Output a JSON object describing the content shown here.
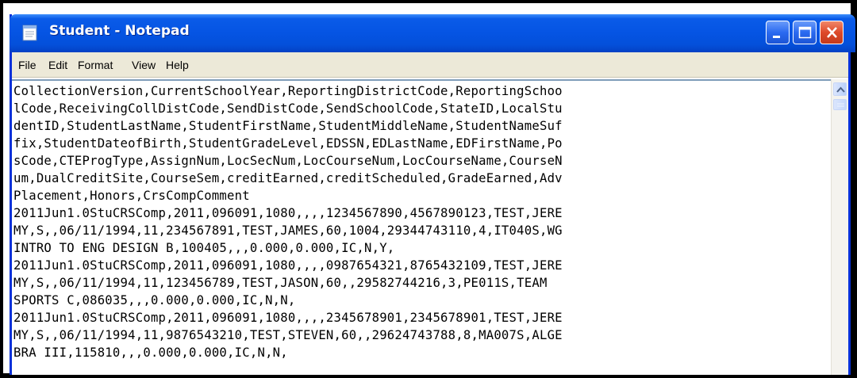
{
  "window": {
    "title": "Student - Notepad"
  },
  "menu": {
    "items": [
      "File",
      "Edit",
      "Format",
      "View",
      "Help"
    ]
  },
  "editor": {
    "lines": [
      "CollectionVersion,CurrentSchoolYear,ReportingDistrictCode,ReportingSchoo",
      "lCode,ReceivingCollDistCode,SendDistCode,SendSchoolCode,StateID,LocalStu",
      "dentID,StudentLastName,StudentFirstName,StudentMiddleName,StudentNameSuf",
      "fix,StudentDateofBirth,StudentGradeLevel,EDSSN,EDLastName,EDFirstName,Po",
      "sCode,CTEProgType,AssignNum,LocSecNum,LocCourseNum,LocCourseName,CourseN",
      "um,DualCreditSite,CourseSem,creditEarned,creditScheduled,GradeEarned,Adv",
      "Placement,Honors,CrsCompComment",
      "2011Jun1.0StuCRSComp,2011,096091,1080,,,,1234567890,4567890123,TEST,JERE",
      "MY,S,,06/11/1994,11,234567891,TEST,JAMES,60,1004,29344743110,4,IT040S,WG",
      "INTRO TO ENG DESIGN B,100405,,,0.000,0.000,IC,N,Y,",
      "2011Jun1.0StuCRSComp,2011,096091,1080,,,,0987654321,8765432109,TEST,JERE",
      "MY,S,,06/11/1994,11,123456789,TEST,JASON,60,,29582744216,3,PE011S,TEAM",
      "SPORTS C,086035,,,0.000,0.000,IC,N,N,",
      "2011Jun1.0StuCRSComp,2011,096091,1080,,,,2345678901,2345678901,TEST,JERE",
      "MY,S,,06/11/1994,11,9876543210,TEST,STEVEN,60,,29624743788,8,MA007S,ALGE",
      "BRA III,115810,,,0.000,0.000,IC,N,N,"
    ]
  },
  "colors": {
    "titlebar": "#0554e3",
    "close_button": "#de4a2a",
    "menubar": "#ece9d8"
  },
  "icons": {
    "app": "notepad-icon",
    "minimize": "minimize-icon",
    "maximize": "maximize-icon",
    "close": "close-icon"
  }
}
